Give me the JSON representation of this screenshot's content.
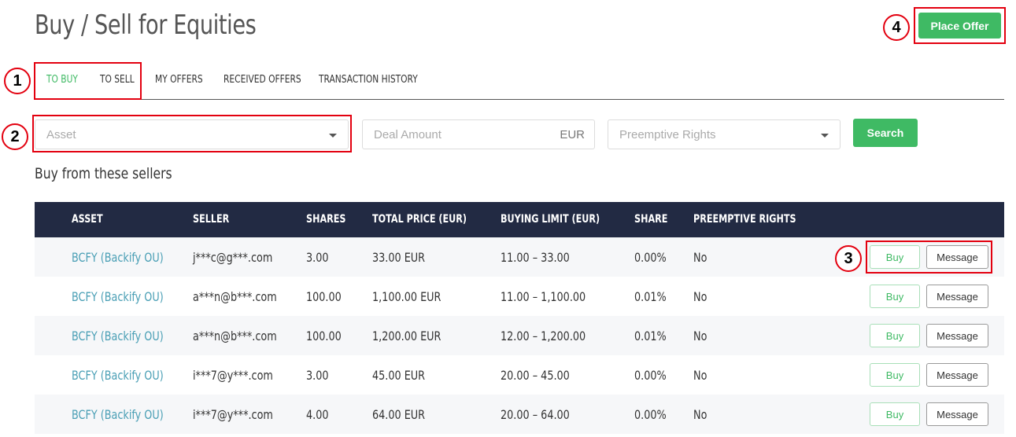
{
  "page": {
    "title": "Buy / Sell for Equities",
    "place_offer_label": "Place Offer"
  },
  "markers": [
    "1",
    "2",
    "3",
    "4"
  ],
  "tabs": [
    {
      "label": "TO BUY",
      "active": true
    },
    {
      "label": "TO SELL",
      "active": false
    },
    {
      "label": "MY OFFERS",
      "active": false
    },
    {
      "label": "RECEIVED OFFERS",
      "active": false
    },
    {
      "label": "TRANSACTION HISTORY",
      "active": false
    }
  ],
  "filters": {
    "asset_placeholder": "Asset",
    "deal_amount_placeholder": "Deal Amount",
    "deal_amount_unit": "EUR",
    "preemptive_placeholder": "Preemptive Rights",
    "search_label": "Search"
  },
  "table": {
    "section_title": "Buy from these sellers",
    "columns": [
      "ASSET",
      "SELLER",
      "SHARES",
      "TOTAL PRICE (EUR)",
      "BUYING LIMIT (EUR)",
      "SHARE",
      "PREEMPTIVE RIGHTS"
    ],
    "buy_label": "Buy",
    "message_label": "Message",
    "rows": [
      [
        "BCFY (Backify OU)",
        "j***c@g***.com",
        "3.00",
        "33.00 EUR",
        "11.00 – 33.00",
        "0.00%",
        "No"
      ],
      [
        "BCFY (Backify OU)",
        "a***n@b***.com",
        "100.00",
        "1,100.00 EUR",
        "11.00 – 1,100.00",
        "0.01%",
        "No"
      ],
      [
        "BCFY (Backify OU)",
        "a***n@b***.com",
        "100.00",
        "1,200.00 EUR",
        "12.00 – 1,200.00",
        "0.01%",
        "No"
      ],
      [
        "BCFY (Backify OU)",
        "i***7@y***.com",
        "3.00",
        "45.00 EUR",
        "20.00 – 45.00",
        "0.00%",
        "No"
      ],
      [
        "BCFY (Backify OU)",
        "i***7@y***.com",
        "4.00",
        "64.00 EUR",
        "20.00 – 64.00",
        "0.00%",
        "No"
      ]
    ]
  },
  "colors": {
    "accent_green": "#3fba64",
    "header_navy": "#222a43",
    "link_teal": "#4a9fb5",
    "highlight_red": "#e3000f"
  }
}
